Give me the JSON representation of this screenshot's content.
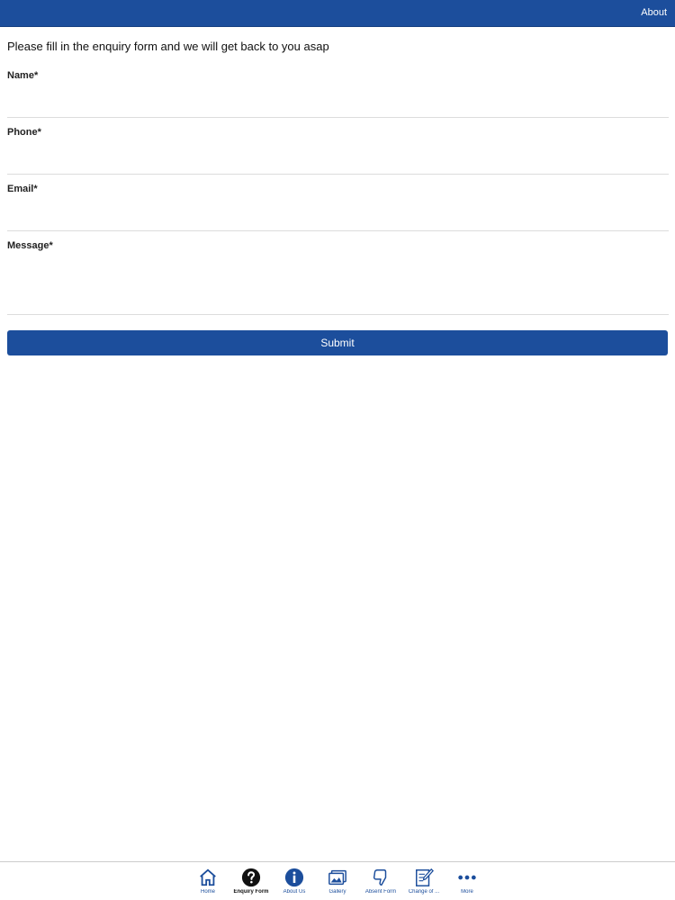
{
  "header": {
    "about_label": "About"
  },
  "form": {
    "intro": "Please fill in the enquiry form and we will get back to you asap",
    "fields": {
      "name": {
        "label": "Name*",
        "value": ""
      },
      "phone": {
        "label": "Phone*",
        "value": ""
      },
      "email": {
        "label": "Email*",
        "value": ""
      },
      "message": {
        "label": "Message*",
        "value": ""
      }
    },
    "submit_label": "Submit"
  },
  "tab_bar": {
    "items": [
      {
        "label": "Home",
        "icon": "home-icon",
        "active": false
      },
      {
        "label": "Enquiry Form",
        "icon": "question-icon",
        "active": true
      },
      {
        "label": "About Us",
        "icon": "info-icon",
        "active": false
      },
      {
        "label": "Gallery",
        "icon": "gallery-icon",
        "active": false
      },
      {
        "label": "Absent Form",
        "icon": "thumbs-down-icon",
        "active": false
      },
      {
        "label": "Change of ...",
        "icon": "edit-document-icon",
        "active": false
      },
      {
        "label": "More",
        "icon": "more-icon",
        "active": false
      }
    ]
  },
  "colors": {
    "brand_blue": "#1c4e9c",
    "active_icon": "#111111"
  }
}
